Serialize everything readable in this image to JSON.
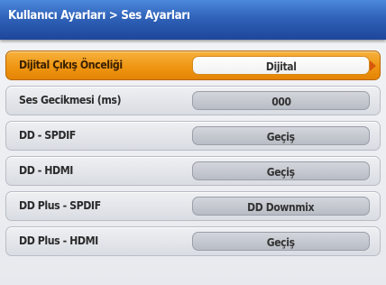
{
  "header": {
    "breadcrumb": "Kullanıcı Ayarları > Ses Ayarları"
  },
  "settings": [
    {
      "label": "Dijital Çıkış Önceliği",
      "value": "Dijital",
      "selected": true
    },
    {
      "label": "Ses Gecikmesi (ms)",
      "value": "000",
      "selected": false
    },
    {
      "label": "DD - SPDIF",
      "value": "Geçiş",
      "selected": false
    },
    {
      "label": "DD - HDMI",
      "value": "Geçiş",
      "selected": false
    },
    {
      "label": "DD Plus - SPDIF",
      "value": "DD Downmix",
      "selected": false
    },
    {
      "label": "DD Plus - HDMI",
      "value": "Geçiş",
      "selected": false
    }
  ],
  "icons": {
    "selection_arrow": "right-arrow-icon"
  },
  "colors": {
    "title_bar": "#2f62b8",
    "selected_row": "#ef9612",
    "row": "#e2e5ea",
    "arrow": "#d4570a"
  }
}
